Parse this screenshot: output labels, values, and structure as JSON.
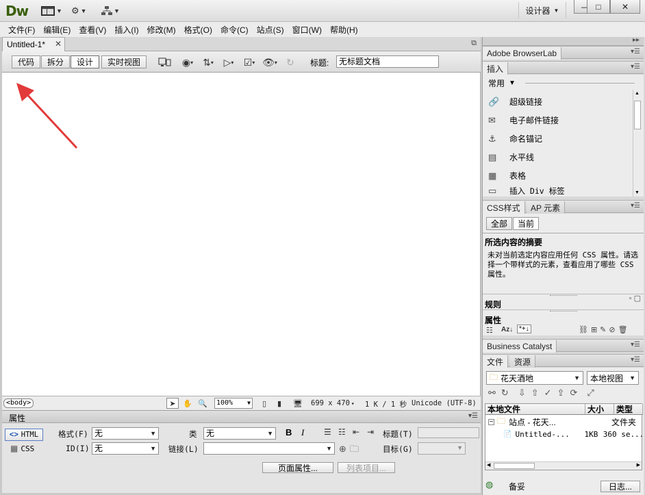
{
  "app": {
    "logo": "Dw",
    "workspace": "设计器",
    "window_buttons": [
      "—",
      "□",
      "✕"
    ]
  },
  "menu": [
    "文件(F)",
    "编辑(E)",
    "查看(V)",
    "插入(I)",
    "修改(M)",
    "格式(O)",
    "命令(C)",
    "站点(S)",
    "窗口(W)",
    "帮助(H)"
  ],
  "document": {
    "tab_label": "Untitled-1*",
    "view_buttons": [
      "代码",
      "拆分",
      "设计",
      "实时视图"
    ],
    "active_view": "设计",
    "title_label": "标题:",
    "title_value": "无标题文档"
  },
  "statusbar": {
    "tag": "<body>",
    "zoom": "100%",
    "dimensions": "699 x 470",
    "download": "1 K / 1 秒",
    "encoding": "Unicode (UTF-8)"
  },
  "properties": {
    "title": "属性",
    "html_btn": "HTML",
    "css_btn": "CSS",
    "format_label": "格式(F)",
    "format_value": "无",
    "id_label": "ID(I)",
    "id_value": "无",
    "class_label": "类",
    "class_value": "无",
    "link_label": "链接(L)",
    "link_value": "",
    "bold": "B",
    "italic": "I",
    "title_field_label": "标题(T)",
    "target_label": "目标(G)",
    "page_props_btn": "页面属性...",
    "list_item_btn": "列表项目..."
  },
  "right_panels": {
    "browserlab": "Adobe BrowserLab",
    "insert_tab": "插入",
    "insert_category": "常用",
    "insert_items": [
      {
        "icon": "hyperlink-icon",
        "label": "超级链接"
      },
      {
        "icon": "email-link-icon",
        "label": "电子邮件链接"
      },
      {
        "icon": "named-anchor-icon",
        "label": "命名锚记"
      },
      {
        "icon": "horizontal-rule-icon",
        "label": "水平线"
      },
      {
        "icon": "table-icon",
        "label": "表格"
      },
      {
        "icon": "div-tag-icon",
        "label": "插入 Div 标签"
      }
    ],
    "css_tab": "CSS样式",
    "ap_tab": "AP 元素",
    "css_all": "全部",
    "css_current": "当前",
    "summary_title": "所选内容的摘要",
    "summary_text": "未对当前选定内容应用任何 CSS 属性。请选择一个带样式的元素，查看应用了哪些 CSS 属性。",
    "rules_label": "规则",
    "props_label": "属性",
    "business_catalyst": "Business Catalyst",
    "files_tab": "文件",
    "assets_tab": "资源",
    "site_select": "花天酒地",
    "view_select": "本地视图",
    "files_headers": [
      "本地文件",
      "大小",
      "类型"
    ],
    "files_rows": [
      {
        "name": "站点 - 花天...",
        "size": "",
        "type": "文件夹"
      },
      {
        "name": "Untitled-...",
        "size": "1KB",
        "type": "360 se..."
      }
    ],
    "files_footer_status": "备妥",
    "log_btn": "日志..."
  }
}
